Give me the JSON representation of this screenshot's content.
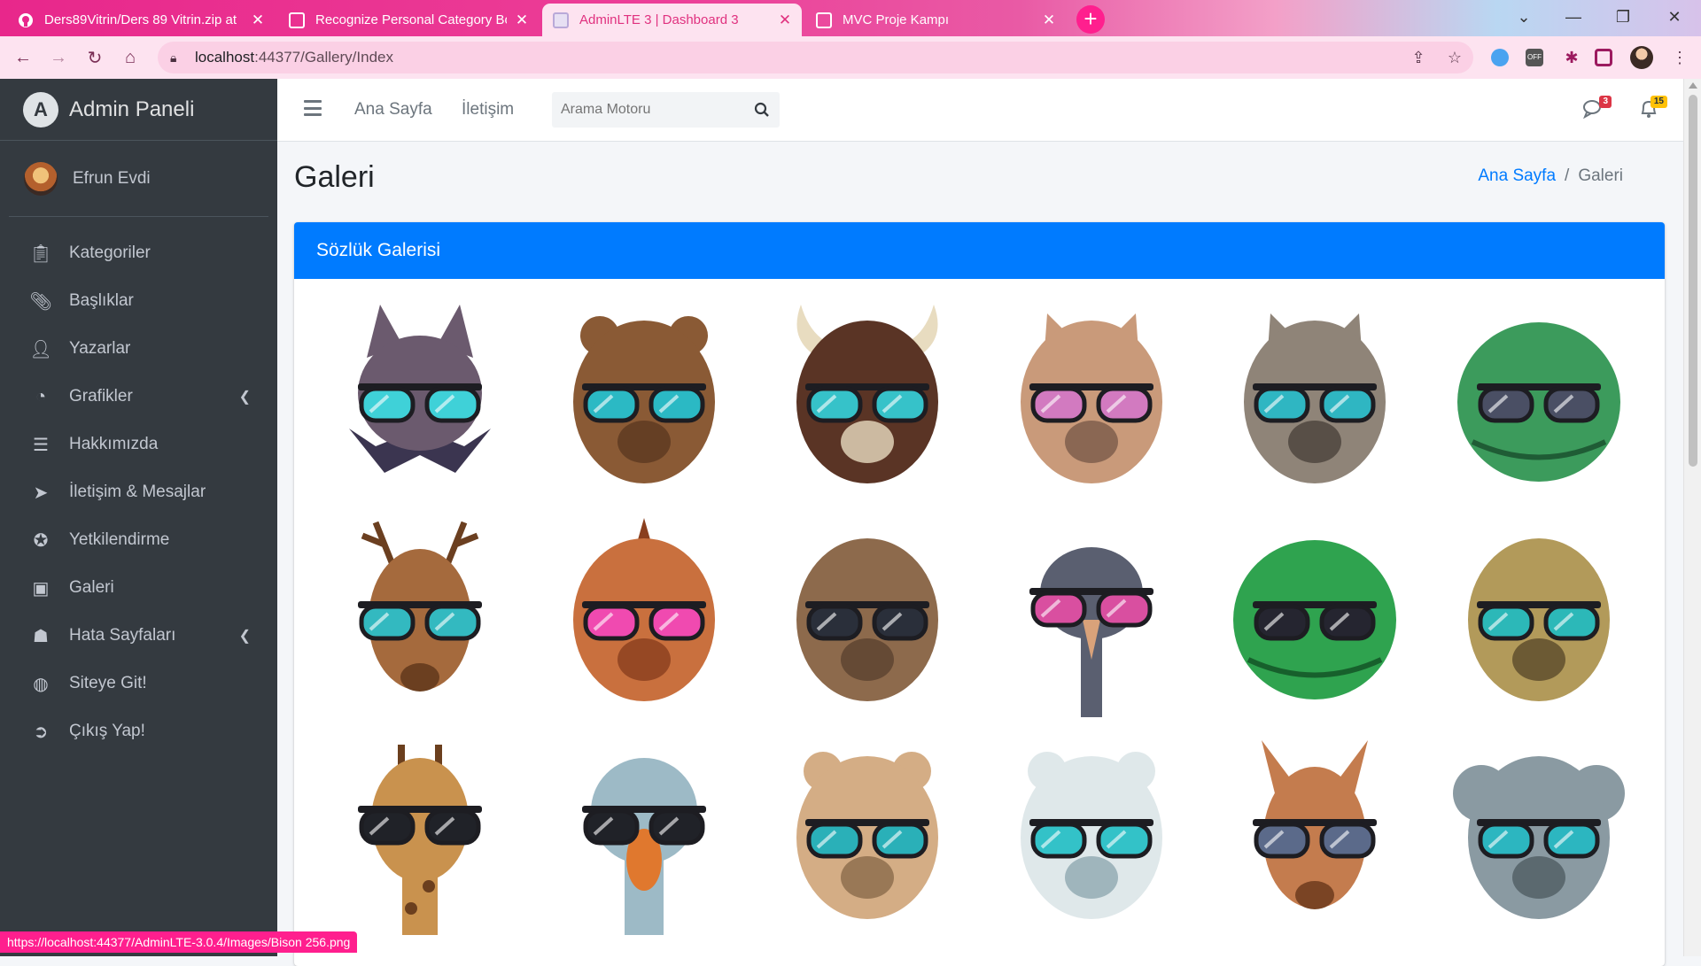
{
  "browser": {
    "tabs": [
      {
        "title": "Ders89Vitrin/Ders 89 Vitrin.zip at",
        "icon": "github-icon",
        "active": false
      },
      {
        "title": "Recognize Personal Category Bo",
        "icon": "page-icon",
        "active": false
      },
      {
        "title": "AdminLTE 3 | Dashboard 3",
        "icon": "page-icon",
        "active": true
      },
      {
        "title": "MVC Proje Kampı",
        "icon": "page-icon",
        "active": false
      }
    ],
    "url_host": "localhost",
    "url_path": ":44377/Gallery/Index",
    "status_url": "https://localhost:44377/AdminLTE-3.0.4/Images/Bison 256.png"
  },
  "sidebar": {
    "brand": "Admin Paneli",
    "user": "Efrun Evdi",
    "items": [
      {
        "label": "Kategoriler",
        "icon": "clipboard-icon",
        "arrow": false
      },
      {
        "label": "Başlıklar",
        "icon": "paperclip-icon",
        "arrow": false
      },
      {
        "label": "Yazarlar",
        "icon": "user-edit-icon",
        "arrow": false
      },
      {
        "label": "Grafikler",
        "icon": "pie-chart-icon",
        "arrow": true
      },
      {
        "label": "Hakkımızda",
        "icon": "layers-icon",
        "arrow": false
      },
      {
        "label": "İletişim & Mesajlar",
        "icon": "paper-plane-icon",
        "arrow": false
      },
      {
        "label": "Yetkilendirme",
        "icon": "award-icon",
        "arrow": false
      },
      {
        "label": "Galeri",
        "icon": "image-icon",
        "arrow": false
      },
      {
        "label": "Hata Sayfaları",
        "icon": "poop-icon",
        "arrow": true
      },
      {
        "label": "Siteye Git!",
        "icon": "globe-icon",
        "arrow": false
      },
      {
        "label": "Çıkış Yap!",
        "icon": "arrow-circle-right-icon",
        "arrow": false
      }
    ]
  },
  "topnav": {
    "home": "Ana Sayfa",
    "contact": "İletişim",
    "search_placeholder": "Arama Motoru",
    "messages_count": "3",
    "notifications_count": "15"
  },
  "page": {
    "title": "Galeri",
    "breadcrumb_home": "Ana Sayfa",
    "breadcrumb_current": "Galeri",
    "card_title": "Sözlük Galerisi"
  },
  "gallery": [
    {
      "animal": "bat",
      "fur": "#6b5a6e",
      "accent": "#3b3550",
      "lens": "#3fd1d8"
    },
    {
      "animal": "bear",
      "fur": "#8a5a35",
      "accent": "#5b3820",
      "lens": "#2bb9c4"
    },
    {
      "animal": "bison",
      "fur": "#5a3425",
      "accent": "#e8dcc0",
      "lens": "#36c2c9"
    },
    {
      "animal": "cat",
      "fur": "#c99a7a",
      "accent": "#7a5a4a",
      "lens": "#d27ac0"
    },
    {
      "animal": "tabby-cat",
      "fur": "#8f8478",
      "accent": "#4a423b",
      "lens": "#2fb6c2"
    },
    {
      "animal": "crocodile",
      "fur": "#3c9b5c",
      "accent": "#1f5c35",
      "lens": "#4a4f64"
    },
    {
      "animal": "deer",
      "fur": "#a56a3d",
      "accent": "#6b3f20",
      "lens": "#33b9c0"
    },
    {
      "animal": "dinosaur",
      "fur": "#c9703e",
      "accent": "#8a3f1e",
      "lens": "#f04ab0"
    },
    {
      "animal": "dog",
      "fur": "#8d6a4c",
      "accent": "#5b4230",
      "lens": "#2a2f3a"
    },
    {
      "animal": "ostrich",
      "fur": "#5a5f70",
      "accent": "#2f3340",
      "lens": "#d94fa0"
    },
    {
      "animal": "frog",
      "fur": "#2fa34f",
      "accent": "#17602c",
      "lens": "#252530"
    },
    {
      "animal": "lizard",
      "fur": "#b29a5a",
      "accent": "#5a4a2a",
      "lens": "#2cb8b8"
    },
    {
      "animal": "giraffe",
      "fur": "#c9924e",
      "accent": "#6b3f1e",
      "lens": "#202228"
    },
    {
      "animal": "goose",
      "fur": "#9dbac6",
      "accent": "#e0782e",
      "lens": "#202228"
    },
    {
      "animal": "hamster",
      "fur": "#d4ad85",
      "accent": "#8a6a4a",
      "lens": "#2ab0b8"
    },
    {
      "animal": "polar-bear",
      "fur": "#dfe8ea",
      "accent": "#8ea8b0",
      "lens": "#33c2c8"
    },
    {
      "animal": "kangaroo",
      "fur": "#c47c4e",
      "accent": "#7a4424",
      "lens": "#5b6a8a"
    },
    {
      "animal": "koala",
      "fur": "#8a9aa2",
      "accent": "#4f5c63",
      "lens": "#2cb6c0"
    }
  ]
}
